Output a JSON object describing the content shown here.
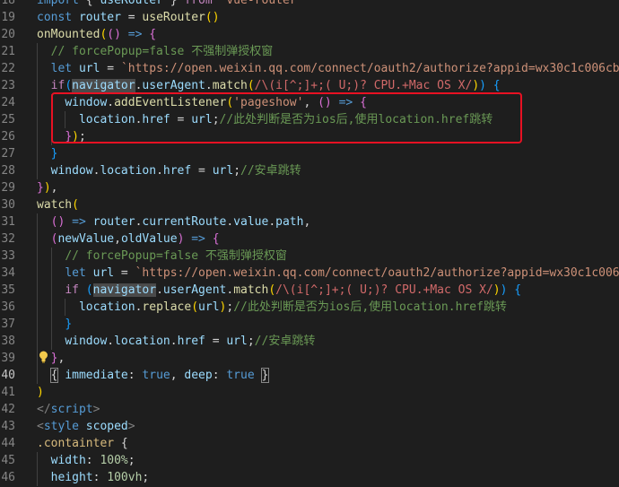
{
  "editor": {
    "lines": [
      {
        "n": "18",
        "indent": 0,
        "tokens": [
          [
            "kw",
            "import"
          ],
          [
            "txt",
            " { "
          ],
          [
            "var",
            "useRouter"
          ],
          [
            "txt",
            " } "
          ],
          [
            "ctrl",
            "from"
          ],
          [
            "txt",
            " "
          ],
          [
            "str",
            "'vue-router'"
          ]
        ]
      },
      {
        "n": "19",
        "indent": 0,
        "tokens": [
          [
            "kw",
            "const"
          ],
          [
            "txt",
            " "
          ],
          [
            "var",
            "router"
          ],
          [
            "txt",
            " = "
          ],
          [
            "fn",
            "useRouter"
          ],
          [
            "b1",
            "()"
          ]
        ]
      },
      {
        "n": "20",
        "indent": 0,
        "tokens": [
          [
            "fn",
            "onMounted"
          ],
          [
            "b1",
            "("
          ],
          [
            "b2",
            "()"
          ],
          [
            "txt",
            " "
          ],
          [
            "kw",
            "=>"
          ],
          [
            "txt",
            " "
          ],
          [
            "b2",
            "{"
          ]
        ]
      },
      {
        "n": "21",
        "indent": 1,
        "tokens": [
          [
            "txt",
            "  "
          ],
          [
            "com",
            "// forcePopup=false 不强制弹授权窗"
          ]
        ]
      },
      {
        "n": "22",
        "indent": 1,
        "tokens": [
          [
            "txt",
            "  "
          ],
          [
            "kw",
            "let"
          ],
          [
            "txt",
            " "
          ],
          [
            "var",
            "url"
          ],
          [
            "txt",
            " = "
          ],
          [
            "str",
            "`https://open.weixin.qq.com/connect/oauth2/authorize?appid=wx30c1c006cb1a"
          ]
        ]
      },
      {
        "n": "23",
        "indent": 1,
        "tokens": [
          [
            "txt",
            "  "
          ],
          [
            "ctrl",
            "if"
          ],
          [
            "b3",
            "("
          ],
          [
            "hl",
            "navigator"
          ],
          [
            "txt",
            "."
          ],
          [
            "var",
            "userAgent"
          ],
          [
            "txt",
            "."
          ],
          [
            "fn",
            "match"
          ],
          [
            "b1",
            "("
          ],
          [
            "rx",
            "/\\(i[^;]+;( U;)? CPU.+Mac OS X/"
          ],
          [
            "b1",
            ")"
          ],
          [
            "b3",
            ")"
          ],
          [
            "txt",
            " "
          ],
          [
            "b3",
            "{"
          ]
        ]
      },
      {
        "n": "24",
        "indent": 2,
        "tokens": [
          [
            "txt",
            "    "
          ],
          [
            "var",
            "window"
          ],
          [
            "txt",
            "."
          ],
          [
            "fn",
            "addEventListener"
          ],
          [
            "b1",
            "("
          ],
          [
            "str",
            "'pageshow'"
          ],
          [
            "txt",
            ", "
          ],
          [
            "b2",
            "()"
          ],
          [
            "txt",
            " "
          ],
          [
            "kw",
            "=>"
          ],
          [
            "txt",
            " "
          ],
          [
            "b2",
            "{"
          ]
        ]
      },
      {
        "n": "25",
        "indent": 3,
        "tokens": [
          [
            "txt",
            "      "
          ],
          [
            "var",
            "location"
          ],
          [
            "txt",
            "."
          ],
          [
            "var",
            "href"
          ],
          [
            "txt",
            " = "
          ],
          [
            "var",
            "url"
          ],
          [
            "txt",
            ";"
          ],
          [
            "com",
            "//此处判断是否为ios后,使用location.href跳转"
          ]
        ]
      },
      {
        "n": "26",
        "indent": 2,
        "tokens": [
          [
            "txt",
            "    "
          ],
          [
            "b2",
            "}"
          ],
          [
            "b1",
            ")"
          ],
          [
            "txt",
            ";"
          ]
        ]
      },
      {
        "n": "27",
        "indent": 1,
        "tokens": [
          [
            "txt",
            "  "
          ],
          [
            "b3",
            "}"
          ]
        ]
      },
      {
        "n": "28",
        "indent": 1,
        "tokens": [
          [
            "txt",
            "  "
          ],
          [
            "var",
            "window"
          ],
          [
            "txt",
            "."
          ],
          [
            "var",
            "location"
          ],
          [
            "txt",
            "."
          ],
          [
            "var",
            "href"
          ],
          [
            "txt",
            " = "
          ],
          [
            "var",
            "url"
          ],
          [
            "txt",
            ";"
          ],
          [
            "com",
            "//安卓跳转"
          ]
        ]
      },
      {
        "n": "29",
        "indent": 0,
        "tokens": [
          [
            "b2",
            "}"
          ],
          [
            "b1",
            ")"
          ],
          [
            "txt",
            ","
          ]
        ]
      },
      {
        "n": "30",
        "indent": 0,
        "tokens": [
          [
            "fn",
            "watch"
          ],
          [
            "b1",
            "("
          ]
        ]
      },
      {
        "n": "31",
        "indent": 1,
        "tokens": [
          [
            "txt",
            "  "
          ],
          [
            "b2",
            "()"
          ],
          [
            "txt",
            " "
          ],
          [
            "kw",
            "=>"
          ],
          [
            "txt",
            " "
          ],
          [
            "var",
            "router"
          ],
          [
            "txt",
            "."
          ],
          [
            "var",
            "currentRoute"
          ],
          [
            "txt",
            "."
          ],
          [
            "var",
            "value"
          ],
          [
            "txt",
            "."
          ],
          [
            "var",
            "path"
          ],
          [
            "txt",
            ","
          ]
        ]
      },
      {
        "n": "32",
        "indent": 1,
        "tokens": [
          [
            "txt",
            "  "
          ],
          [
            "b2",
            "("
          ],
          [
            "var",
            "newValue"
          ],
          [
            "txt",
            ","
          ],
          [
            "var",
            "oldValue"
          ],
          [
            "b2",
            ")"
          ],
          [
            "txt",
            " "
          ],
          [
            "kw",
            "=>"
          ],
          [
            "txt",
            " "
          ],
          [
            "b2",
            "{"
          ]
        ]
      },
      {
        "n": "33",
        "indent": 2,
        "tokens": [
          [
            "txt",
            "    "
          ],
          [
            "com",
            "// forcePopup=false 不强制弹授权窗"
          ]
        ]
      },
      {
        "n": "34",
        "indent": 2,
        "tokens": [
          [
            "txt",
            "    "
          ],
          [
            "kw",
            "let"
          ],
          [
            "txt",
            " "
          ],
          [
            "var",
            "url"
          ],
          [
            "txt",
            " = "
          ],
          [
            "str",
            "`https://open.weixin.qq.com/connect/oauth2/authorize?appid=wx30c1c006cb"
          ]
        ]
      },
      {
        "n": "35",
        "indent": 2,
        "tokens": [
          [
            "txt",
            "    "
          ],
          [
            "ctrl",
            "if"
          ],
          [
            "txt",
            " "
          ],
          [
            "b3",
            "("
          ],
          [
            "hl",
            "navigator"
          ],
          [
            "txt",
            "."
          ],
          [
            "var",
            "userAgent"
          ],
          [
            "txt",
            "."
          ],
          [
            "fn",
            "match"
          ],
          [
            "b1",
            "("
          ],
          [
            "rx",
            "/\\(i[^;]+;( U;)? CPU.+Mac OS X/"
          ],
          [
            "b1",
            ")"
          ],
          [
            "b3",
            ")"
          ],
          [
            "txt",
            " "
          ],
          [
            "b3",
            "{"
          ]
        ]
      },
      {
        "n": "36",
        "indent": 3,
        "tokens": [
          [
            "txt",
            "      "
          ],
          [
            "var",
            "location"
          ],
          [
            "txt",
            "."
          ],
          [
            "fn",
            "replace"
          ],
          [
            "b1",
            "("
          ],
          [
            "var",
            "url"
          ],
          [
            "b1",
            ")"
          ],
          [
            "txt",
            ";"
          ],
          [
            "com",
            "//此处判断是否为ios后,使用location.href跳转"
          ]
        ]
      },
      {
        "n": "37",
        "indent": 2,
        "tokens": [
          [
            "txt",
            "    "
          ],
          [
            "b3",
            "}"
          ]
        ]
      },
      {
        "n": "38",
        "indent": 2,
        "tokens": [
          [
            "txt",
            "    "
          ],
          [
            "var",
            "window"
          ],
          [
            "txt",
            "."
          ],
          [
            "var",
            "location"
          ],
          [
            "txt",
            "."
          ],
          [
            "var",
            "href"
          ],
          [
            "txt",
            " = "
          ],
          [
            "var",
            "url"
          ],
          [
            "txt",
            ";"
          ],
          [
            "com",
            "//安卓跳转"
          ]
        ]
      },
      {
        "n": "39",
        "indent": 1,
        "tokens": [
          [
            "txt",
            "  "
          ],
          [
            "b2",
            "}"
          ],
          [
            "txt",
            ","
          ]
        ]
      },
      {
        "n": "40",
        "indent": 1,
        "active": true,
        "tokens": [
          [
            "txt",
            "  "
          ],
          [
            "box",
            "{"
          ],
          [
            "txt",
            " "
          ],
          [
            "var",
            "immediate"
          ],
          [
            "txt",
            ": "
          ],
          [
            "bool",
            "true"
          ],
          [
            "txt",
            ", "
          ],
          [
            "var",
            "deep"
          ],
          [
            "txt",
            ": "
          ],
          [
            "bool",
            "true"
          ],
          [
            "txt",
            " "
          ],
          [
            "box",
            "}"
          ]
        ]
      },
      {
        "n": "41",
        "indent": 0,
        "tokens": [
          [
            "b1",
            ")"
          ]
        ]
      },
      {
        "n": "42",
        "indent": 0,
        "tokens": [
          [
            "tagb",
            "</"
          ],
          [
            "tag",
            "script"
          ],
          [
            "tagb",
            ">"
          ]
        ]
      },
      {
        "n": "43",
        "indent": 0,
        "tokens": [
          [
            "tagb",
            "<"
          ],
          [
            "tag",
            "style"
          ],
          [
            "txt",
            " "
          ],
          [
            "attr",
            "scoped"
          ],
          [
            "tagb",
            ">"
          ]
        ]
      },
      {
        "n": "44",
        "indent": 0,
        "tokens": [
          [
            "sel",
            ".containter"
          ],
          [
            "txt",
            " {"
          ]
        ]
      },
      {
        "n": "45",
        "indent": 1,
        "tokens": [
          [
            "txt",
            "  "
          ],
          [
            "prop",
            "width"
          ],
          [
            "txt",
            ": "
          ],
          [
            "num",
            "100%"
          ],
          [
            "txt",
            ";"
          ]
        ]
      },
      {
        "n": "46",
        "indent": 1,
        "tokens": [
          [
            "txt",
            "  "
          ],
          [
            "prop",
            "height"
          ],
          [
            "txt",
            ": "
          ],
          [
            "num",
            "100vh"
          ],
          [
            "txt",
            ";"
          ]
        ]
      }
    ]
  },
  "colors": {
    "background": "#1e1e1e",
    "highlight_box": "#e81123",
    "lightbulb": "#f2c94c"
  }
}
